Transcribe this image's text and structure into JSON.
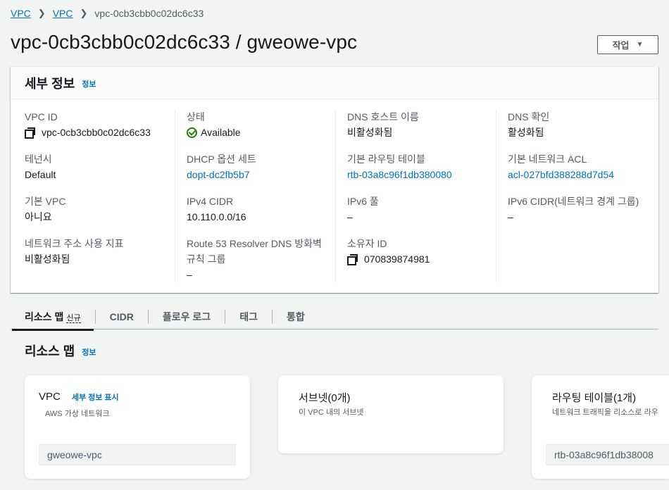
{
  "breadcrumb": {
    "items": [
      "VPC",
      "VPC"
    ],
    "current": "vpc-0cb3cbb0c02dc6c33"
  },
  "page": {
    "title": "vpc-0cb3cbb0c02dc6c33 / gweowe-vpc",
    "actions_label": "작업"
  },
  "details": {
    "title": "세부 정보",
    "info_label": "정보",
    "col1": [
      {
        "label": "VPC ID",
        "value": "vpc-0cb3cbb0c02dc6c33"
      },
      {
        "label": "테넌시",
        "value": "Default"
      },
      {
        "label": "기본 VPC",
        "value": "아니요"
      },
      {
        "label": "네트워크 주소 사용 지표",
        "value": "비활성화됨"
      }
    ],
    "col2": [
      {
        "label": "상태",
        "value": "Available"
      },
      {
        "label": "DHCP 옵션 세트",
        "value": "dopt-dc2fb5b7"
      },
      {
        "label": "IPv4 CIDR",
        "value": "10.110.0.0/16"
      },
      {
        "label": "Route 53 Resolver DNS 방화벽",
        "label2": "규칙 그룹",
        "value": "–"
      }
    ],
    "col3": [
      {
        "label": "DNS 호스트 이름",
        "value": "비활성화됨"
      },
      {
        "label": "기본 라우팅 테이블",
        "value": "rtb-03a8c96f1db380080"
      },
      {
        "label": "IPv6 풀",
        "value": "–"
      },
      {
        "label": "소유자 ID",
        "value": "070839874981"
      }
    ],
    "col4": [
      {
        "label": "DNS 확인",
        "value": "활성화됨"
      },
      {
        "label": "기본 네트워크 ACL",
        "value": "acl-027bfd388288d7d54"
      },
      {
        "label": "IPv6 CIDR(네트워크 경계 그룹)",
        "value": "–"
      }
    ]
  },
  "tabs": [
    {
      "label": "리소스 맵",
      "badge": "신규"
    },
    {
      "label": "CIDR"
    },
    {
      "label": "플로우 로그"
    },
    {
      "label": "태그"
    },
    {
      "label": "통합"
    }
  ],
  "resource_map": {
    "title": "리소스 맵",
    "info_label": "정보",
    "cards": [
      {
        "title": "VPC",
        "link": "세부 정보 표시",
        "subtitle": "AWS 가상 네트워크",
        "chip": "gweowe-vpc"
      },
      {
        "title": "서브넷(0개)",
        "subtitle": "이 VPC 내의 서브넷"
      },
      {
        "title": "라우팅 테이블(1개)",
        "subtitle": "네트워크 트래픽을 리소스로 라우",
        "chip": "rtb-03a8c96f1db38008"
      }
    ]
  },
  "colors": {
    "link": "#0073bb",
    "success": "#1d8102",
    "text": "#16191f",
    "muted": "#545b64",
    "background": "#f2f3f3"
  },
  "icons": [
    "chevron-right-icon",
    "caret-down-icon",
    "copy-icon",
    "status-ok-icon"
  ]
}
